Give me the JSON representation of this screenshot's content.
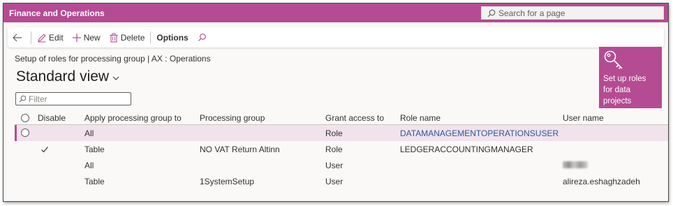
{
  "app": {
    "title": "Finance and Operations"
  },
  "search": {
    "placeholder": "Search for a page"
  },
  "actions": {
    "edit": "Edit",
    "new": "New",
    "delete": "Delete",
    "options": "Options"
  },
  "page": {
    "breadcrumb": "Setup of roles for processing group  |  AX : Operations",
    "view_title": "Standard view"
  },
  "filter": {
    "placeholder": "Filter"
  },
  "tile": {
    "label_line1": "Set up roles",
    "label_line2": "for data",
    "label_line3": "projects",
    "color": "#b54b93"
  },
  "grid": {
    "columns": {
      "disable": "Disable",
      "apply": "Apply processing group to",
      "processing_group": "Processing group",
      "grant": "Grant access to",
      "role": "Role name",
      "user": "User name"
    },
    "rows": [
      {
        "disable": false,
        "apply": "All",
        "processing_group": "",
        "grant": "Role",
        "role": "DATAMANAGEMENTOPERATIONSUSER",
        "user": ""
      },
      {
        "disable": true,
        "apply": "Table",
        "processing_group": "NO VAT Return Altinn",
        "grant": "Role",
        "role": "LEDGERACCOUNTINGMANAGER",
        "user": ""
      },
      {
        "disable": false,
        "apply": "All",
        "processing_group": "",
        "grant": "User",
        "role": "",
        "user": ""
      },
      {
        "disable": false,
        "apply": "Table",
        "processing_group": "1SystemSetup",
        "grant": "User",
        "role": "",
        "user": "alireza.eshaghzadeh"
      }
    ]
  },
  "colors": {
    "brand": "#b54b93",
    "selected_row": "#f2e2ec",
    "link": "#2b579a"
  }
}
